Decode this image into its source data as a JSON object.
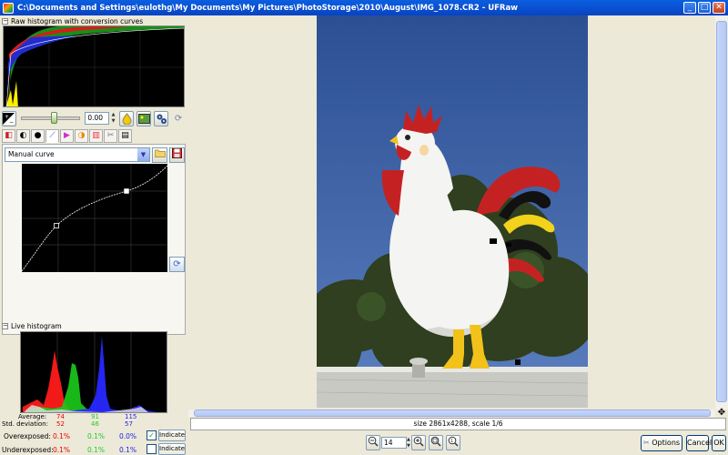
{
  "window": {
    "title": "C:\\Documents and Settings\\eulothg\\My Documents\\My Pictures\\PhotoStorage\\2010\\August\\IMG_1078.CR2 - UFRaw",
    "buttons": {
      "minimize": "_",
      "maximize": "□",
      "close": "✕"
    }
  },
  "raw_histogram": {
    "label": "Raw histogram with conversion curves",
    "toggle": "−"
  },
  "exposure": {
    "value": "0.00",
    "slider_level": 0.5
  },
  "curve": {
    "selected": "Manual curve"
  },
  "live_histogram": {
    "label": "Live histogram",
    "toggle": "−"
  },
  "stats": {
    "average_label": "Average:",
    "std_label": "Std. deviation:",
    "average": [
      "74",
      "91",
      "115"
    ],
    "std": [
      "52",
      "46",
      "57"
    ]
  },
  "exposure_rows": [
    {
      "label": "Overexposed:",
      "r": "0.1%",
      "g": "0.1%",
      "b": "0.0%",
      "checked": true,
      "button": "Indicate"
    },
    {
      "label": "Underexposed:",
      "r": "0.1%",
      "g": "0.1%",
      "b": "0.1%",
      "checked": false,
      "button": "Indicate"
    }
  ],
  "status": {
    "text": "size 2861x4288, scale 1/6"
  },
  "zoom": {
    "value": "14"
  },
  "actions": {
    "options": "Options",
    "cancel": "Cancel",
    "ok": "OK"
  },
  "colors": {
    "accent": "#0a5fe0",
    "sky": "#3a5b9a"
  }
}
